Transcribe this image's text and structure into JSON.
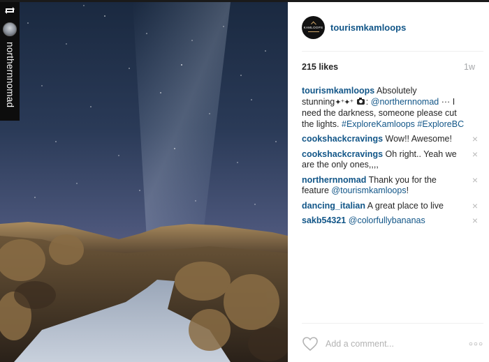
{
  "repost": {
    "username": "northernnomad",
    "icon": "repost-icon"
  },
  "post": {
    "account": {
      "username": "tourismkamloops",
      "avatar_text": "KAMLOOPS"
    },
    "likes": "215 likes",
    "time": "1w",
    "caption": {
      "user": "tourismkamloops",
      "text_part1": "Absolutely stunning",
      "sparkles": "✦⁺✦⁺",
      "colon": ":",
      "mention": "@northernnomad",
      "dots": "···",
      "text_part2": "I need the darkness, someone please cut the lights.",
      "tags": [
        "#ExploreKamloops",
        "#ExploreBC"
      ]
    },
    "comments": [
      {
        "user": "cookshackcravings",
        "text": "Wow!! Awesome!"
      },
      {
        "user": "cookshackcravings",
        "text": "Oh right.. Yeah we are the only ones,,,,"
      },
      {
        "user": "northernnomad",
        "text": "Thank you for the feature",
        "mention": "@tourismkamloops",
        "after": "!"
      },
      {
        "user": "dancing_italian",
        "text": "A great place to live"
      },
      {
        "user": "sakb54321",
        "text": "",
        "mention": "@colorfullybananas"
      }
    ],
    "add_comment_placeholder": "Add a comment...",
    "more_label": "○○○",
    "delete_label": "×"
  },
  "colors": {
    "link": "#125688",
    "text": "#262626",
    "muted": "#a5a7aa"
  }
}
